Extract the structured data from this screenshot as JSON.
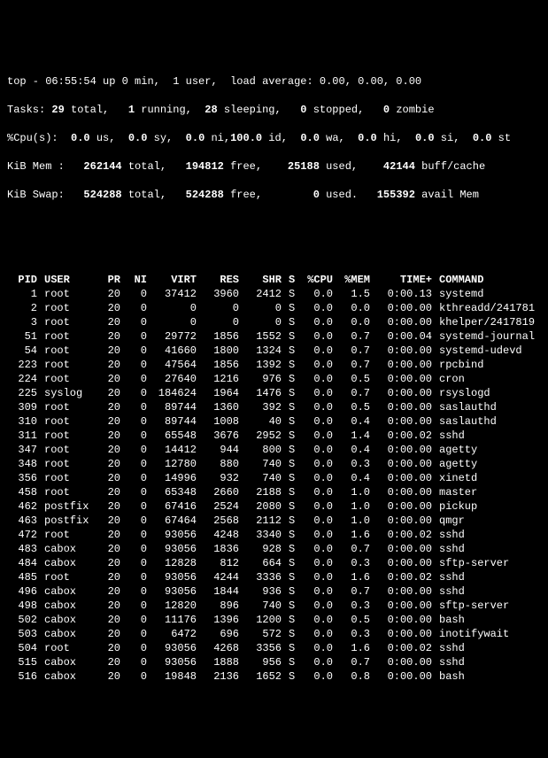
{
  "summary": {
    "line1_pre": "top - ",
    "time": "06:55:54",
    "up": " up 0 min,  ",
    "users": "1 user,",
    "load_label": "  load average: ",
    "load": "0.00, 0.00, 0.00",
    "tasks_label": "Tasks: ",
    "tasks_total": "29",
    "tasks_total_l": " total,   ",
    "tasks_run": "1",
    "tasks_run_l": " running,  ",
    "tasks_sleep": "28",
    "tasks_sleep_l": " sleeping,   ",
    "tasks_stop": "0",
    "tasks_stop_l": " stopped,   ",
    "tasks_zom": "0",
    "tasks_zom_l": " zombie",
    "cpu_label": "%Cpu(s):  ",
    "cpu_us": "0.0",
    "cpu_us_l": " us,  ",
    "cpu_sy": "0.0",
    "cpu_sy_l": " sy,  ",
    "cpu_ni": "0.0",
    "cpu_ni_l": " ni,",
    "cpu_id": "100.0",
    "cpu_id_l": " id,  ",
    "cpu_wa": "0.0",
    "cpu_wa_l": " wa,  ",
    "cpu_hi": "0.0",
    "cpu_hi_l": " hi,  ",
    "cpu_si": "0.0",
    "cpu_si_l": " si,  ",
    "cpu_st": "0.0",
    "cpu_st_l": " st",
    "mem_label": "KiB Mem :   ",
    "mem_total": "262144",
    "mem_total_l": " total,   ",
    "mem_free": "194812",
    "mem_free_l": " free,    ",
    "mem_used": "25188",
    "mem_used_l": " used,    ",
    "mem_buff": "42144",
    "mem_buff_l": " buff/cache",
    "swap_label": "KiB Swap:   ",
    "swap_total": "524288",
    "swap_total_l": " total,   ",
    "swap_free": "524288",
    "swap_free_l": " free,        ",
    "swap_used": "0",
    "swap_used_l": " used.   ",
    "swap_avail": "155392",
    "swap_avail_l": " avail Mem"
  },
  "cols": {
    "pid": "PID",
    "user": "USER",
    "pr": "PR",
    "ni": "NI",
    "virt": "VIRT",
    "res": "RES",
    "shr": "SHR",
    "s": "S",
    "cpu": "%CPU",
    "mem": "%MEM",
    "time": "TIME+",
    "cmd": "COMMAND"
  },
  "rows": [
    {
      "pid": "1",
      "user": "root",
      "pr": "20",
      "ni": "0",
      "virt": "37412",
      "res": "3960",
      "shr": "2412",
      "s": "S",
      "cpu": "0.0",
      "mem": "1.5",
      "time": "0:00.13",
      "cmd": "systemd"
    },
    {
      "pid": "2",
      "user": "root",
      "pr": "20",
      "ni": "0",
      "virt": "0",
      "res": "0",
      "shr": "0",
      "s": "S",
      "cpu": "0.0",
      "mem": "0.0",
      "time": "0:00.00",
      "cmd": "kthreadd/241781"
    },
    {
      "pid": "3",
      "user": "root",
      "pr": "20",
      "ni": "0",
      "virt": "0",
      "res": "0",
      "shr": "0",
      "s": "S",
      "cpu": "0.0",
      "mem": "0.0",
      "time": "0:00.00",
      "cmd": "khelper/2417819"
    },
    {
      "pid": "51",
      "user": "root",
      "pr": "20",
      "ni": "0",
      "virt": "29772",
      "res": "1856",
      "shr": "1552",
      "s": "S",
      "cpu": "0.0",
      "mem": "0.7",
      "time": "0:00.04",
      "cmd": "systemd-journal"
    },
    {
      "pid": "54",
      "user": "root",
      "pr": "20",
      "ni": "0",
      "virt": "41660",
      "res": "1800",
      "shr": "1324",
      "s": "S",
      "cpu": "0.0",
      "mem": "0.7",
      "time": "0:00.00",
      "cmd": "systemd-udevd"
    },
    {
      "pid": "223",
      "user": "root",
      "pr": "20",
      "ni": "0",
      "virt": "47564",
      "res": "1856",
      "shr": "1392",
      "s": "S",
      "cpu": "0.0",
      "mem": "0.7",
      "time": "0:00.00",
      "cmd": "rpcbind"
    },
    {
      "pid": "224",
      "user": "root",
      "pr": "20",
      "ni": "0",
      "virt": "27640",
      "res": "1216",
      "shr": "976",
      "s": "S",
      "cpu": "0.0",
      "mem": "0.5",
      "time": "0:00.00",
      "cmd": "cron"
    },
    {
      "pid": "225",
      "user": "syslog",
      "pr": "20",
      "ni": "0",
      "virt": "184624",
      "res": "1964",
      "shr": "1476",
      "s": "S",
      "cpu": "0.0",
      "mem": "0.7",
      "time": "0:00.00",
      "cmd": "rsyslogd"
    },
    {
      "pid": "309",
      "user": "root",
      "pr": "20",
      "ni": "0",
      "virt": "89744",
      "res": "1360",
      "shr": "392",
      "s": "S",
      "cpu": "0.0",
      "mem": "0.5",
      "time": "0:00.00",
      "cmd": "saslauthd"
    },
    {
      "pid": "310",
      "user": "root",
      "pr": "20",
      "ni": "0",
      "virt": "89744",
      "res": "1008",
      "shr": "40",
      "s": "S",
      "cpu": "0.0",
      "mem": "0.4",
      "time": "0:00.00",
      "cmd": "saslauthd"
    },
    {
      "pid": "311",
      "user": "root",
      "pr": "20",
      "ni": "0",
      "virt": "65548",
      "res": "3676",
      "shr": "2952",
      "s": "S",
      "cpu": "0.0",
      "mem": "1.4",
      "time": "0:00.02",
      "cmd": "sshd"
    },
    {
      "pid": "347",
      "user": "root",
      "pr": "20",
      "ni": "0",
      "virt": "14412",
      "res": "944",
      "shr": "800",
      "s": "S",
      "cpu": "0.0",
      "mem": "0.4",
      "time": "0:00.00",
      "cmd": "agetty"
    },
    {
      "pid": "348",
      "user": "root",
      "pr": "20",
      "ni": "0",
      "virt": "12780",
      "res": "880",
      "shr": "740",
      "s": "S",
      "cpu": "0.0",
      "mem": "0.3",
      "time": "0:00.00",
      "cmd": "agetty"
    },
    {
      "pid": "356",
      "user": "root",
      "pr": "20",
      "ni": "0",
      "virt": "14996",
      "res": "932",
      "shr": "740",
      "s": "S",
      "cpu": "0.0",
      "mem": "0.4",
      "time": "0:00.00",
      "cmd": "xinetd"
    },
    {
      "pid": "458",
      "user": "root",
      "pr": "20",
      "ni": "0",
      "virt": "65348",
      "res": "2660",
      "shr": "2188",
      "s": "S",
      "cpu": "0.0",
      "mem": "1.0",
      "time": "0:00.00",
      "cmd": "master"
    },
    {
      "pid": "462",
      "user": "postfix",
      "pr": "20",
      "ni": "0",
      "virt": "67416",
      "res": "2524",
      "shr": "2080",
      "s": "S",
      "cpu": "0.0",
      "mem": "1.0",
      "time": "0:00.00",
      "cmd": "pickup"
    },
    {
      "pid": "463",
      "user": "postfix",
      "pr": "20",
      "ni": "0",
      "virt": "67464",
      "res": "2568",
      "shr": "2112",
      "s": "S",
      "cpu": "0.0",
      "mem": "1.0",
      "time": "0:00.00",
      "cmd": "qmgr"
    },
    {
      "pid": "472",
      "user": "root",
      "pr": "20",
      "ni": "0",
      "virt": "93056",
      "res": "4248",
      "shr": "3340",
      "s": "S",
      "cpu": "0.0",
      "mem": "1.6",
      "time": "0:00.02",
      "cmd": "sshd"
    },
    {
      "pid": "483",
      "user": "cabox",
      "pr": "20",
      "ni": "0",
      "virt": "93056",
      "res": "1836",
      "shr": "928",
      "s": "S",
      "cpu": "0.0",
      "mem": "0.7",
      "time": "0:00.00",
      "cmd": "sshd"
    },
    {
      "pid": "484",
      "user": "cabox",
      "pr": "20",
      "ni": "0",
      "virt": "12828",
      "res": "812",
      "shr": "664",
      "s": "S",
      "cpu": "0.0",
      "mem": "0.3",
      "time": "0:00.00",
      "cmd": "sftp-server"
    },
    {
      "pid": "485",
      "user": "root",
      "pr": "20",
      "ni": "0",
      "virt": "93056",
      "res": "4244",
      "shr": "3336",
      "s": "S",
      "cpu": "0.0",
      "mem": "1.6",
      "time": "0:00.02",
      "cmd": "sshd"
    },
    {
      "pid": "496",
      "user": "cabox",
      "pr": "20",
      "ni": "0",
      "virt": "93056",
      "res": "1844",
      "shr": "936",
      "s": "S",
      "cpu": "0.0",
      "mem": "0.7",
      "time": "0:00.00",
      "cmd": "sshd"
    },
    {
      "pid": "498",
      "user": "cabox",
      "pr": "20",
      "ni": "0",
      "virt": "12820",
      "res": "896",
      "shr": "740",
      "s": "S",
      "cpu": "0.0",
      "mem": "0.3",
      "time": "0:00.00",
      "cmd": "sftp-server"
    },
    {
      "pid": "502",
      "user": "cabox",
      "pr": "20",
      "ni": "0",
      "virt": "11176",
      "res": "1396",
      "shr": "1200",
      "s": "S",
      "cpu": "0.0",
      "mem": "0.5",
      "time": "0:00.00",
      "cmd": "bash"
    },
    {
      "pid": "503",
      "user": "cabox",
      "pr": "20",
      "ni": "0",
      "virt": "6472",
      "res": "696",
      "shr": "572",
      "s": "S",
      "cpu": "0.0",
      "mem": "0.3",
      "time": "0:00.00",
      "cmd": "inotifywait"
    },
    {
      "pid": "504",
      "user": "root",
      "pr": "20",
      "ni": "0",
      "virt": "93056",
      "res": "4268",
      "shr": "3356",
      "s": "S",
      "cpu": "0.0",
      "mem": "1.6",
      "time": "0:00.02",
      "cmd": "sshd"
    },
    {
      "pid": "515",
      "user": "cabox",
      "pr": "20",
      "ni": "0",
      "virt": "93056",
      "res": "1888",
      "shr": "956",
      "s": "S",
      "cpu": "0.0",
      "mem": "0.7",
      "time": "0:00.00",
      "cmd": "sshd"
    },
    {
      "pid": "516",
      "user": "cabox",
      "pr": "20",
      "ni": "0",
      "virt": "19848",
      "res": "2136",
      "shr": "1652",
      "s": "S",
      "cpu": "0.0",
      "mem": "0.8",
      "time": "0:00.00",
      "cmd": "bash"
    }
  ]
}
